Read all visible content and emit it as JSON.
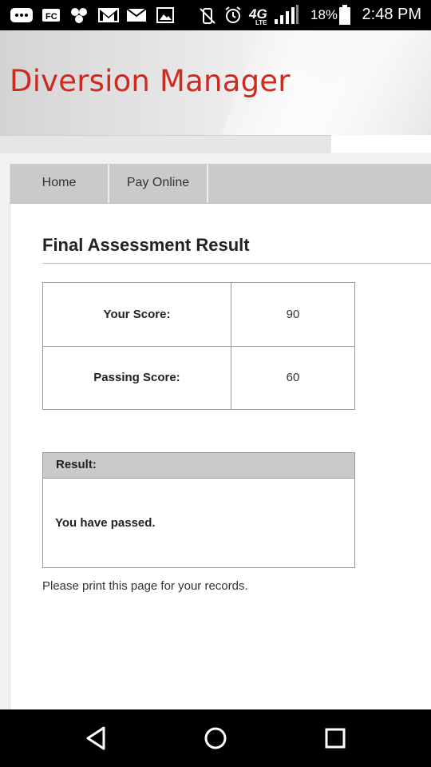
{
  "status_bar": {
    "battery": "18%",
    "time": "2:48 PM",
    "network": "4G",
    "network_sub": "LTE",
    "icons": [
      "messages-icon",
      "fx-app-icon",
      "app-cluster-icon",
      "gmail-icon",
      "email-icon",
      "gallery-icon",
      "vibrate-off-icon",
      "alarm-icon",
      "signal-icon",
      "battery-icon"
    ]
  },
  "header": {
    "app_title": "Diversion Manager",
    "title_color": "#cf2a1f"
  },
  "nav": {
    "items": [
      {
        "label": "Home"
      },
      {
        "label": "Pay Online"
      }
    ]
  },
  "main": {
    "page_title": "Final Assessment Result",
    "scores": [
      {
        "label": "Your Score:",
        "value": "90"
      },
      {
        "label": "Passing Score:",
        "value": "60"
      }
    ],
    "result": {
      "header": "Result:",
      "message": "You have passed."
    },
    "print_note": "Please print this page for your records."
  },
  "system_nav": {
    "icons": [
      "back-icon",
      "home-icon",
      "recents-icon"
    ]
  }
}
